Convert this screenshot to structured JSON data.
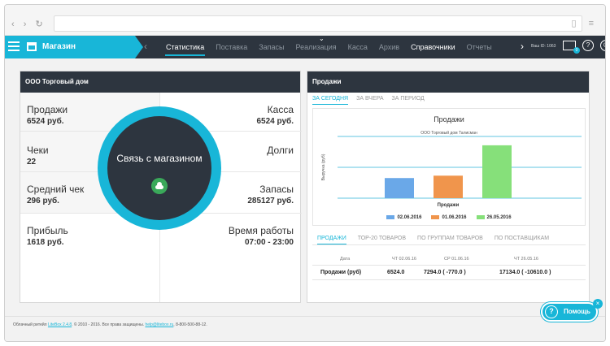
{
  "browser": {
    "nav_arrows": "‹ › ↻",
    "chrome_icons": "▯ ≡"
  },
  "app": {
    "brand_label": "Магазин",
    "tabs": [
      "Статистика",
      "Поставка",
      "Запасы",
      "Реализация",
      "Касса",
      "Архив",
      "Справочники",
      "Отчеты"
    ],
    "active_tab": "Статистика",
    "user_id": "Ваш ID: 1063",
    "mail_badge": "0",
    "help_glyph": "?"
  },
  "left_panel": {
    "title": "ООО Торговый дом",
    "stats": [
      {
        "label": "Продажи",
        "value": "6524 руб."
      },
      {
        "label": "Чеки",
        "value": "22"
      },
      {
        "label": "Средний чек",
        "value": "296 руб."
      },
      {
        "label": "Прибыль",
        "value": "1618 руб."
      },
      {
        "label": "Касса",
        "value": "6524 руб."
      },
      {
        "label": "Долги",
        "value": ""
      },
      {
        "label": "Запасы",
        "value": "285127 руб."
      },
      {
        "label": "Время работы",
        "value": "07:00 - 23:00"
      }
    ],
    "connect_label": "Связь с магазином"
  },
  "right_panel": {
    "title": "Продажи",
    "period_tabs": [
      "ЗА СЕГОДНЯ",
      "ЗА ВЧЕРА",
      "ЗА ПЕРИОД"
    ],
    "bottom_tabs": [
      "ПРОДАЖИ",
      "ТОР-20 ТОВАРОВ",
      "ПО ГРУППАМ ТОВАРОВ",
      "ПО ПОСТАВЩИКАМ"
    ],
    "table": {
      "headers": [
        "Дата",
        "ЧТ 02.06.16",
        "СР 01.06.16",
        "ЧТ 26.05.16"
      ],
      "rows": [
        [
          "Продажи (руб)",
          "6524.0",
          "7294.0 ( -770.0 )",
          "17134.0 ( -10610.0 )"
        ]
      ]
    }
  },
  "chart_data": {
    "type": "bar",
    "title": "Продажи",
    "subtitle": "ООО Торговый дом Талисман",
    "ylabel": "Выручка (руб)",
    "xlabel": "Продажи",
    "categories": [
      "Продажи"
    ],
    "ylim": [
      0,
      20000
    ],
    "grid": true,
    "legend_position": "bottom",
    "series": [
      {
        "name": "02.06.2016",
        "values": [
          6524
        ],
        "color": "#6aa8e8"
      },
      {
        "name": "01.06.2016",
        "values": [
          7294
        ],
        "color": "#f0954c"
      },
      {
        "name": "26.05.2016",
        "values": [
          17134
        ],
        "color": "#86e07a"
      }
    ]
  },
  "footer": {
    "text_prefix": "Облачный ритейл ",
    "link1": "LiteBox 2.4.8",
    "text_mid": ". © 2010 - 2016. Все права защищены. ",
    "link2": "help@litebox.ru",
    "text_suffix": ", 8-800-500-88-12."
  },
  "help_button": {
    "label": "Помощь",
    "close": "×"
  },
  "colors": {
    "accent": "#18b6d8",
    "dark": "#2d353f"
  }
}
